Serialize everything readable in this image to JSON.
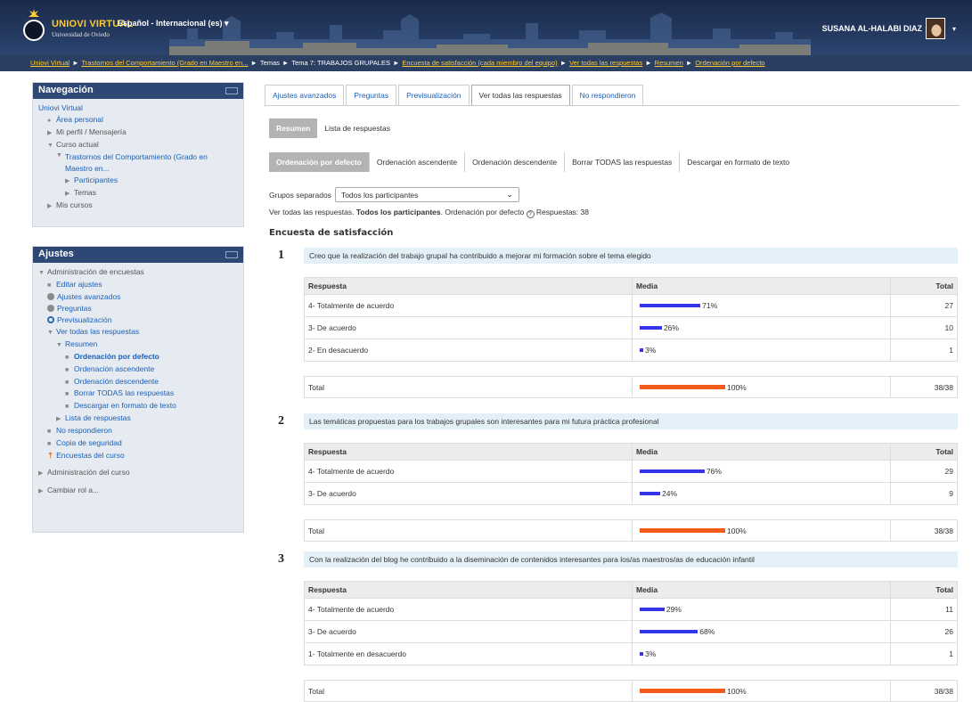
{
  "header": {
    "site_name_a": "UNIOVI",
    "site_name_b": "VIRTUAL",
    "site_sub": "Universidad de Oviedo",
    "language": "Español - Internacional (es) ▾",
    "user_name": "SUSANA AL-HALABI DIAZ",
    "user_caret": "▾"
  },
  "breadcrumb": {
    "items": [
      {
        "label": "Uniovi Virtual",
        "link": true
      },
      {
        "label": "Trastornos del Comportamiento (Grado en Maestro en...",
        "link": true
      },
      {
        "label": "Temas",
        "link": false
      },
      {
        "label": "Tema 7: TRABAJOS GRUPALES",
        "link": false
      },
      {
        "label": "Encuesta de satisfacción (cada miembro del equipo)",
        "link": true
      },
      {
        "label": "Ver todas las respuestas",
        "link": true
      },
      {
        "label": "Resumen",
        "link": true
      },
      {
        "label": "Ordenación por defecto",
        "link": true
      }
    ],
    "separator": "►"
  },
  "nav_block": {
    "title": "Navegación",
    "items": {
      "home": "Uniovi Virtual",
      "area": "Área personal",
      "profile": "Mi perfil / Mensajería",
      "course_current": "Curso actual",
      "course_name": "Trastornos del Comportamiento (Grado en Maestro en...",
      "participants": "Participantes",
      "topics": "Temas",
      "my_courses": "Mis cursos"
    }
  },
  "settings_block": {
    "title": "Ajustes",
    "items": {
      "admin_surveys": "Administración de encuestas",
      "edit": "Editar ajustes",
      "advanced": "Ajustes avanzados",
      "questions": "Preguntas",
      "preview": "Previsualización",
      "view_all": "Ver todas las respuestas",
      "summary": "Resumen",
      "order_default": "Ordenación por defecto",
      "order_asc": "Ordenación ascendente",
      "order_desc": "Ordenación descendente",
      "delete_all": "Borrar TODAS las respuestas",
      "download": "Descargar en formato de texto",
      "list": "Lista de respuestas",
      "no_response": "No respondieron",
      "backup": "Copia de seguridad",
      "course_surveys": "Encuestas del curso",
      "course_admin": "Administración del curso",
      "change_role": "Cambiar rol a..."
    }
  },
  "tabs": [
    "Ajustes avanzados",
    "Preguntas",
    "Previsualización",
    "Ver todas las respuestas",
    "No respondieron"
  ],
  "subtabs": [
    "Resumen",
    "Lista de respuestas"
  ],
  "sorttabs": [
    "Ordenación por defecto",
    "Ordenación ascendente",
    "Ordenación descendente",
    "Borrar TODAS las respuestas",
    "Descargar en formato de texto"
  ],
  "groups": {
    "label": "Grupos separados",
    "selected": "Todos los participantes"
  },
  "summary": {
    "prefix": "Ver todas las respuestas.",
    "bold": "Todos los participantes",
    "suffix": ". Ordenación por defecto",
    "help": "?",
    "responses": "Respuestas: 38"
  },
  "survey_title": "Encuesta de satisfacción",
  "table_headers": {
    "response": "Respuesta",
    "mean": "Media",
    "total": "Total"
  },
  "questions": [
    {
      "number": "1",
      "text": "Creo que la realización del trabajo grupal ha contribuido a  mejorar mi formación sobre el tema elegido",
      "rows": [
        {
          "label": "4- Totalmente de acuerdo",
          "pct": 71,
          "pct_label": "71%",
          "total": "27"
        },
        {
          "label": "3- De acuerdo",
          "pct": 26,
          "pct_label": "26%",
          "total": "10"
        },
        {
          "label": "2- En desacuerdo",
          "pct": 3,
          "pct_label": "3%",
          "total": "1"
        }
      ],
      "total_label": "Total",
      "total_pct_label": "100%",
      "total_value": "38/38"
    },
    {
      "number": "2",
      "text": "Las temáticas propuestas para los trabajos grupales son interesantes para mi futura práctica profesional",
      "rows": [
        {
          "label": "4- Totalmente de acuerdo",
          "pct": 76,
          "pct_label": "76%",
          "total": "29"
        },
        {
          "label": "3- De acuerdo",
          "pct": 24,
          "pct_label": "24%",
          "total": "9"
        }
      ],
      "total_label": "Total",
      "total_pct_label": "100%",
      "total_value": "38/38"
    },
    {
      "number": "3",
      "text": "Con la realización del blog he contribuido a la diseminación de contenidos interesantes para los/as maestros/as de educación infantil",
      "rows": [
        {
          "label": "4- Totalmente de acuerdo",
          "pct": 29,
          "pct_label": "29%",
          "total": "11"
        },
        {
          "label": "3- De acuerdo",
          "pct": 68,
          "pct_label": "68%",
          "total": "26"
        },
        {
          "label": "1- Totalmente en desacuerdo",
          "pct": 3,
          "pct_label": "3%",
          "total": "1"
        }
      ],
      "total_label": "Total",
      "total_pct_label": "100%",
      "total_value": "38/38"
    }
  ],
  "colors": {
    "bar": "#3434e8",
    "total_bar": "#f25a1c",
    "header": "#1b2a4a",
    "accent": "#ffcc33"
  }
}
